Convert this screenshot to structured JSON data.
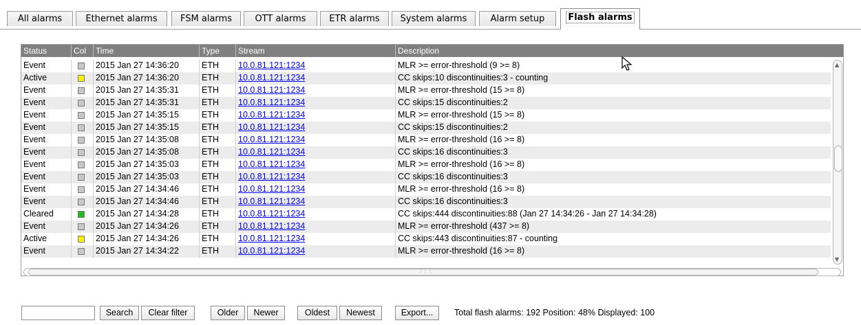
{
  "tabs": [
    {
      "label": "All alarms",
      "active": false
    },
    {
      "label": "Ethernet alarms",
      "active": false
    },
    {
      "label": "FSM alarms",
      "active": false
    },
    {
      "label": "OTT alarms",
      "active": false
    },
    {
      "label": "ETR alarms",
      "active": false
    },
    {
      "label": "System alarms",
      "active": false
    },
    {
      "label": "Alarm setup",
      "active": false
    },
    {
      "label": "Flash alarms",
      "active": true
    }
  ],
  "table": {
    "columns": [
      "Status",
      "Col",
      "Time",
      "Type",
      "Stream",
      "Description"
    ],
    "rows": [
      {
        "status": "Event",
        "color": "#c8c8c8",
        "time": "2015 Jan 27 14:36:20",
        "type": "ETH",
        "stream": "10.0.81.121:1234",
        "desc": "MLR >= error-threshold (9 >= 8)"
      },
      {
        "status": "Active",
        "color": "#ffee00",
        "time": "2015 Jan 27 14:36:20",
        "type": "ETH",
        "stream": "10.0.81.121:1234",
        "desc": "CC skips:10 discontinuities:3 - counting"
      },
      {
        "status": "Event",
        "color": "#c8c8c8",
        "time": "2015 Jan 27 14:35:31",
        "type": "ETH",
        "stream": "10.0.81.121:1234",
        "desc": "MLR >= error-threshold (15 >= 8)"
      },
      {
        "status": "Event",
        "color": "#c8c8c8",
        "time": "2015 Jan 27 14:35:31",
        "type": "ETH",
        "stream": "10.0.81.121:1234",
        "desc": "CC skips:15 discontinuities:2"
      },
      {
        "status": "Event",
        "color": "#c8c8c8",
        "time": "2015 Jan 27 14:35:15",
        "type": "ETH",
        "stream": "10.0.81.121:1234",
        "desc": "MLR >= error-threshold (15 >= 8)"
      },
      {
        "status": "Event",
        "color": "#c8c8c8",
        "time": "2015 Jan 27 14:35:15",
        "type": "ETH",
        "stream": "10.0.81.121:1234",
        "desc": "CC skips:15 discontinuities:2"
      },
      {
        "status": "Event",
        "color": "#c8c8c8",
        "time": "2015 Jan 27 14:35:08",
        "type": "ETH",
        "stream": "10.0.81.121:1234",
        "desc": "MLR >= error-threshold (16 >= 8)"
      },
      {
        "status": "Event",
        "color": "#c8c8c8",
        "time": "2015 Jan 27 14:35:08",
        "type": "ETH",
        "stream": "10.0.81.121:1234",
        "desc": "CC skips:16 discontinuities:3"
      },
      {
        "status": "Event",
        "color": "#c8c8c8",
        "time": "2015 Jan 27 14:35:03",
        "type": "ETH",
        "stream": "10.0.81.121:1234",
        "desc": "MLR >= error-threshold (16 >= 8)"
      },
      {
        "status": "Event",
        "color": "#c8c8c8",
        "time": "2015 Jan 27 14:35:03",
        "type": "ETH",
        "stream": "10.0.81.121:1234",
        "desc": "CC skips:16 discontinuities:3"
      },
      {
        "status": "Event",
        "color": "#c8c8c8",
        "time": "2015 Jan 27 14:34:46",
        "type": "ETH",
        "stream": "10.0.81.121:1234",
        "desc": "MLR >= error-threshold (16 >= 8)"
      },
      {
        "status": "Event",
        "color": "#c8c8c8",
        "time": "2015 Jan 27 14:34:46",
        "type": "ETH",
        "stream": "10.0.81.121:1234",
        "desc": "CC skips:16 discontinuities:3"
      },
      {
        "status": "Cleared",
        "color": "#22bb22",
        "time": "2015 Jan 27 14:34:28",
        "type": "ETH",
        "stream": "10.0.81.121:1234",
        "desc": "CC skips:444 discontinuities:88 (Jan 27 14:34:26 - Jan 27 14:34:28)"
      },
      {
        "status": "Event",
        "color": "#c8c8c8",
        "time": "2015 Jan 27 14:34:26",
        "type": "ETH",
        "stream": "10.0.81.121:1234",
        "desc": "MLR >= error-threshold (437 >= 8)"
      },
      {
        "status": "Active",
        "color": "#ffee00",
        "time": "2015 Jan 27 14:34:26",
        "type": "ETH",
        "stream": "10.0.81.121:1234",
        "desc": "CC skips:443 discontinuities:87 - counting"
      },
      {
        "status": "Event",
        "color": "#c8c8c8",
        "time": "2015 Jan 27 14:34:22",
        "type": "ETH",
        "stream": "10.0.81.121:1234",
        "desc": "MLR >= error-threshold (16 >= 8)"
      }
    ]
  },
  "toolbar": {
    "search_value": "",
    "search_label": "Search",
    "clear_filter_label": "Clear filter",
    "older_label": "Older",
    "newer_label": "Newer",
    "oldest_label": "Oldest",
    "newest_label": "Newest",
    "export_label": "Export..."
  },
  "status": {
    "text": "Total flash alarms: 192  Position: 48%  Displayed: 100"
  }
}
